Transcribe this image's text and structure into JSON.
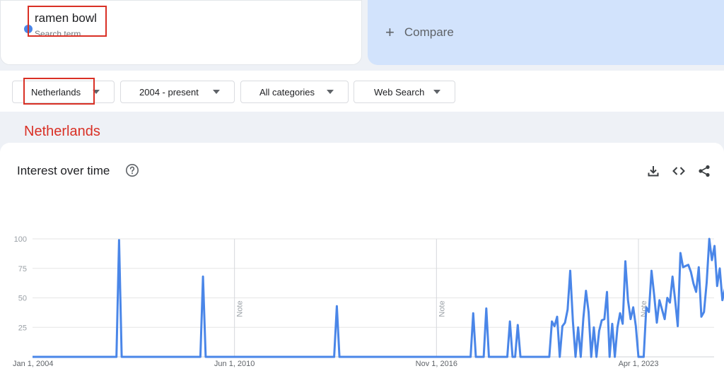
{
  "search": {
    "term": "ramen bowl",
    "term_subtitle": "Search term",
    "term_color": "#4a86e8"
  },
  "compare": {
    "label": "Compare",
    "icon": "plus-icon"
  },
  "filters": {
    "region": "Netherlands",
    "time_range": "2004 - present",
    "category": "All categories",
    "search_type": "Web Search"
  },
  "annotation_text": "Netherlands",
  "chart_section": {
    "title": "Interest over time",
    "help_icon": "help-circle-icon",
    "actions": [
      "download-icon",
      "embed-code-icon",
      "share-icon"
    ]
  },
  "chart_data": {
    "type": "line",
    "title": "Interest over time",
    "y_ticks": [
      25,
      50,
      75,
      100
    ],
    "ylim": [
      0,
      100
    ],
    "x_tick_labels": [
      "Jan 1, 2004",
      "Jun 1, 2010",
      "Nov 1, 2016",
      "Apr 1, 2023"
    ],
    "x_tick_dates": [
      "2004-01",
      "2010-06",
      "2016-11",
      "2023-04"
    ],
    "note_marker_dates": [
      "2010-06",
      "2016-11",
      "2023-04"
    ],
    "note_label": "Note",
    "partial_from": "2024-09",
    "line_color": "#4a86e8",
    "grid": true,
    "series": [
      {
        "points": [
          [
            "2004-01",
            0
          ],
          [
            "2006-09",
            0
          ],
          [
            "2006-10",
            99
          ],
          [
            "2006-11",
            0
          ],
          [
            "2009-05",
            0
          ],
          [
            "2009-06",
            68
          ],
          [
            "2009-07",
            0
          ],
          [
            "2013-08",
            0
          ],
          [
            "2013-09",
            43
          ],
          [
            "2013-10",
            0
          ],
          [
            "2017-12",
            0
          ],
          [
            "2018-01",
            37
          ],
          [
            "2018-02",
            0
          ],
          [
            "2018-05",
            0
          ],
          [
            "2018-06",
            41
          ],
          [
            "2018-07",
            0
          ],
          [
            "2019-02",
            0
          ],
          [
            "2019-03",
            30
          ],
          [
            "2019-04",
            0
          ],
          [
            "2019-05",
            0
          ],
          [
            "2019-06",
            27
          ],
          [
            "2019-07",
            0
          ],
          [
            "2020-06",
            0
          ],
          [
            "2020-07",
            30
          ],
          [
            "2020-08",
            26
          ],
          [
            "2020-09",
            34
          ],
          [
            "2020-10",
            0
          ],
          [
            "2020-11",
            26
          ],
          [
            "2020-12",
            29
          ],
          [
            "2021-01",
            40
          ],
          [
            "2021-02",
            73
          ],
          [
            "2021-03",
            30
          ],
          [
            "2021-04",
            0
          ],
          [
            "2021-05",
            25
          ],
          [
            "2021-06",
            0
          ],
          [
            "2021-07",
            33
          ],
          [
            "2021-08",
            56
          ],
          [
            "2021-09",
            38
          ],
          [
            "2021-10",
            0
          ],
          [
            "2021-11",
            25
          ],
          [
            "2021-12",
            0
          ],
          [
            "2022-01",
            22
          ],
          [
            "2022-02",
            31
          ],
          [
            "2022-03",
            32
          ],
          [
            "2022-04",
            55
          ],
          [
            "2022-05",
            0
          ],
          [
            "2022-06",
            28
          ],
          [
            "2022-07",
            0
          ],
          [
            "2022-08",
            25
          ],
          [
            "2022-09",
            37
          ],
          [
            "2022-10",
            28
          ],
          [
            "2022-11",
            81
          ],
          [
            "2022-12",
            48
          ],
          [
            "2023-01",
            32
          ],
          [
            "2023-02",
            42
          ],
          [
            "2023-03",
            26
          ],
          [
            "2023-04",
            0
          ],
          [
            "2023-05",
            0
          ],
          [
            "2023-06",
            0
          ],
          [
            "2023-07",
            42
          ],
          [
            "2023-08",
            38
          ],
          [
            "2023-09",
            73
          ],
          [
            "2023-10",
            52
          ],
          [
            "2023-11",
            29
          ],
          [
            "2023-12",
            48
          ],
          [
            "2024-01",
            40
          ],
          [
            "2024-02",
            32
          ],
          [
            "2024-03",
            50
          ],
          [
            "2024-04",
            46
          ],
          [
            "2024-05",
            68
          ],
          [
            "2024-06",
            48
          ],
          [
            "2024-07",
            26
          ],
          [
            "2024-08",
            88
          ],
          [
            "2024-09",
            76
          ],
          [
            "2024-10",
            77
          ],
          [
            "2024-11",
            78
          ],
          [
            "2024-12",
            72
          ],
          [
            "2025-01",
            62
          ],
          [
            "2025-02",
            55
          ],
          [
            "2025-03",
            76
          ],
          [
            "2025-04",
            34
          ],
          [
            "2025-05",
            38
          ],
          [
            "2025-06",
            63
          ],
          [
            "2025-07",
            100
          ],
          [
            "2025-08",
            82
          ],
          [
            "2025-09",
            94
          ],
          [
            "2025-10",
            60
          ],
          [
            "2025-11",
            75
          ],
          [
            "2025-12",
            48
          ],
          [
            "2026-01",
            58
          ],
          [
            "2026-02",
            69
          ],
          [
            "2026-03",
            62
          ]
        ],
        "partial_points": [
          [
            "2026-03",
            62
          ],
          [
            "2026-04",
            35
          ]
        ]
      }
    ]
  }
}
